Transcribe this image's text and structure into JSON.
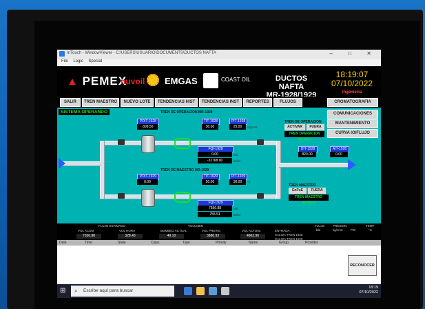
{
  "window": {
    "title": "InTouch - WindowViewer - C:\\USERS\\USUARIO\\DOCUMENTS\\DUCTOS NAFTA",
    "menu": [
      "File",
      "Logic",
      "Special"
    ],
    "controls": [
      "–",
      "□",
      "✕"
    ]
  },
  "header": {
    "pemex": "PEMEX",
    "nuvoil": "nuvoil",
    "emgas": "EMGAS",
    "coast": "COAST OIL",
    "title_line1": "DUCTOS NAFTA",
    "title_line2": "MR-1928/1929",
    "time": "18:19:07",
    "date": "07/10/2022",
    "subtitle": "Ingenieria"
  },
  "toolbar": {
    "buttons": [
      "SALIR",
      "TREN MAESTRO",
      "NUEVO LOTE",
      "TENDENCIAS HIST",
      "TENDENCIAS INST",
      "REPORTES",
      "FLUJOS"
    ]
  },
  "side": {
    "buttons": [
      "CROMATOGRAFIA",
      "COMUNICACIONES",
      "MANTENIMIENTO",
      "CURVA IO/FLUJO"
    ]
  },
  "process": {
    "status": "SISTEMA OPERANDO",
    "tren_op_title": "TREN DE OPERACION MR-1928",
    "tren_ma_title": "TREN DE MAESTRO MR-1929",
    "pdit1": {
      "tag": "PDIT-1928",
      "value": "-399.56"
    },
    "tit1": {
      "tag": "TIT-1928",
      "value": "30.00"
    },
    "pit1": {
      "tag": "PIT-1928",
      "value": "25.00"
    },
    "fqi1": {
      "tag": "FQI-1928",
      "v1": "0.00",
      "v2": "-32768.00",
      "u1": "bbl",
      "u2": "bbl/d"
    },
    "dit": {
      "tag": "DIT-1928",
      "value": "820.00"
    },
    "ait": {
      "tag": "AIT-1928",
      "value": "0.00"
    },
    "pdit2": {
      "tag": "PDIT-1929",
      "value": "0.00"
    },
    "tit2": {
      "tag": "TIT-1929",
      "value": "50.00"
    },
    "pit2": {
      "tag": "PIT-1929",
      "value": "30.00"
    },
    "fqi2": {
      "tag": "FQI-1929",
      "v1": "7556.88",
      "v2": "755.51",
      "u1": "bbl",
      "u2": "bbl/d"
    },
    "unit_kg": "kg/cm2",
    "unit_c": "°C",
    "tren_op_label": "TREN DE OPERACION",
    "activar": "ACTIVAR",
    "fuera": "FUERA",
    "tren_op_activo": "TREN OPERACION ACTIVO",
    "tren_maestro_label": "TREN MAESTRO",
    "enfuera": "EnFuE",
    "fuera2": "FUERA",
    "tren_maestro_activo": "TREN MAESTRO ACTIVO"
  },
  "flows": {
    "left_title": "FLUJO ESTIMADO",
    "mid_title": "VOLUMEN",
    "labels": [
      "VOL ACUM",
      "VOL HORA",
      "BOMBEO ACTUAL",
      "VOL PREVIO",
      "VOL ACTUAL"
    ],
    "values": [
      "7556.88",
      "328.43",
      "49.10",
      "3888.93",
      "4863.96"
    ],
    "entrada": "ENTRADA",
    "salida1": "SALIDA TREN 1928",
    "salida2": "SALIDA TREN 1929",
    "cols": [
      "FLUJO",
      "PRESION",
      "TEMP"
    ],
    "units": [
      "bbl",
      "kg/cm2",
      "PSI",
      "°C"
    ]
  },
  "alarms": {
    "columns": [
      "Date",
      "Time",
      "State",
      "Class",
      "Type",
      "Priority",
      "Name",
      "Group",
      "Provider"
    ],
    "ack": "RECONOCER"
  },
  "taskbar": {
    "search_placeholder": "Escribe aquí para buscar",
    "time": "18:19",
    "date": "07/10/2022"
  },
  "colors": {
    "process_bg": "#00b3b3",
    "tag_blue": "#1a3ad8",
    "status_green": "#1fe01f",
    "clock_yellow": "#ffd200"
  }
}
